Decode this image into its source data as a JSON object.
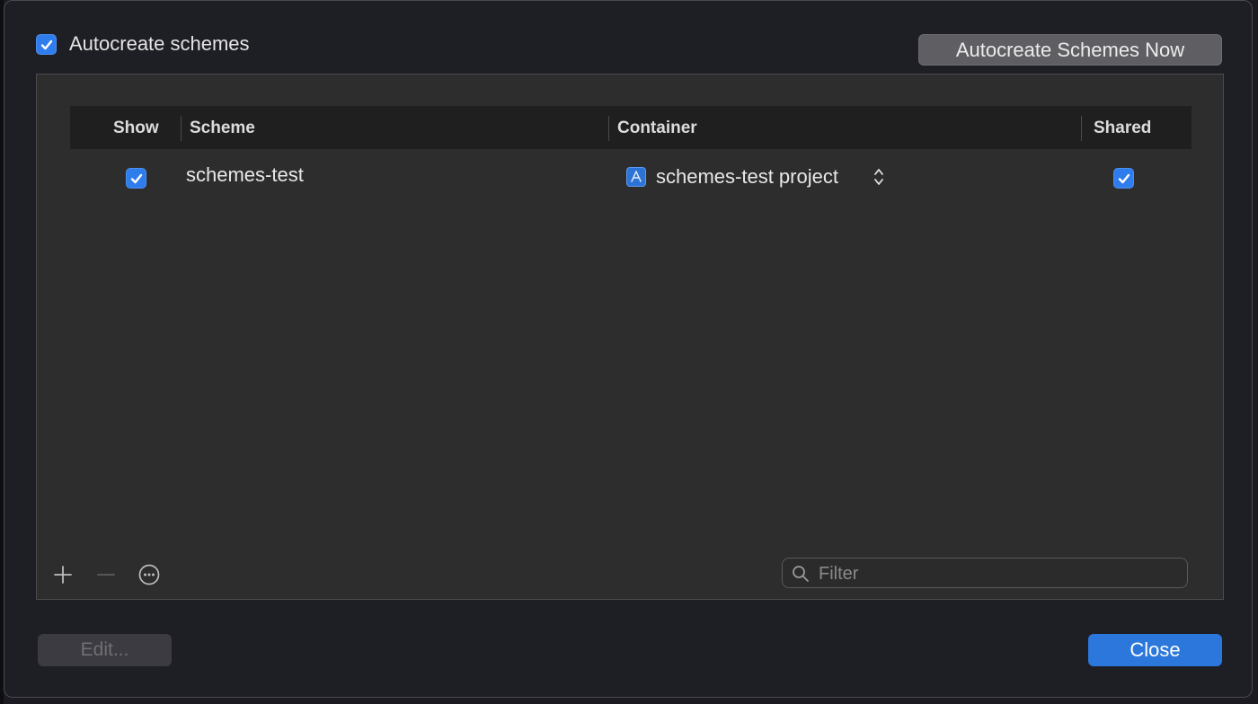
{
  "header": {
    "autocreate_label": "Autocreate schemes",
    "autocreate_checked": true,
    "autocreate_now_label": "Autocreate Schemes Now"
  },
  "table": {
    "columns": [
      "Show",
      "Scheme",
      "Container",
      "Shared"
    ],
    "rows": [
      {
        "show": true,
        "scheme": "schemes-test",
        "container": "schemes-test project",
        "container_icon": "xcode-project-icon",
        "shared": true
      }
    ]
  },
  "toolbar": {
    "add_icon": "plus-icon",
    "remove_icon": "minus-icon",
    "more_icon": "ellipsis-circle-icon"
  },
  "filter": {
    "placeholder": "Filter",
    "value": ""
  },
  "footer": {
    "edit_label": "Edit...",
    "close_label": "Close"
  },
  "colors": {
    "accent": "#2b77db",
    "background": "#1e1e25",
    "panel": "#2d2d2d",
    "header": "#1f1f1f"
  }
}
